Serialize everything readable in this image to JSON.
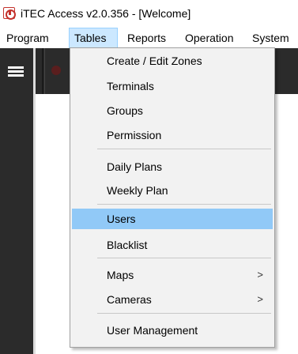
{
  "window": {
    "title": "iTEC Access v2.0.356 - [Welcome]",
    "icon": "app-logo-icon"
  },
  "menubar": {
    "items": [
      {
        "id": "program",
        "label": "Program"
      },
      {
        "id": "tables",
        "label": "Tables"
      },
      {
        "id": "reports",
        "label": "Reports"
      },
      {
        "id": "operation",
        "label": "Operation"
      },
      {
        "id": "system",
        "label": "System"
      }
    ],
    "active": "Tables"
  },
  "tables_menu": {
    "items": [
      {
        "label": "Create / Edit Zones"
      },
      {
        "label": "Terminals"
      },
      {
        "label": "Groups"
      },
      {
        "label": "Permission"
      },
      {
        "label": "Daily Plans"
      },
      {
        "label": "Weekly Plan"
      },
      {
        "label": "Users",
        "highlighted": true
      },
      {
        "label": "Blacklist"
      },
      {
        "label": "Maps",
        "submenu_arrow": ">"
      },
      {
        "label": "Cameras",
        "submenu_arrow": ">"
      },
      {
        "label": "User Management"
      }
    ]
  },
  "colors": {
    "menu_highlight": "#91c9f7",
    "menubar_active": "#cce8ff",
    "sidebar": "#2b2b2b",
    "dropdown_bg": "#f2f2f2"
  }
}
